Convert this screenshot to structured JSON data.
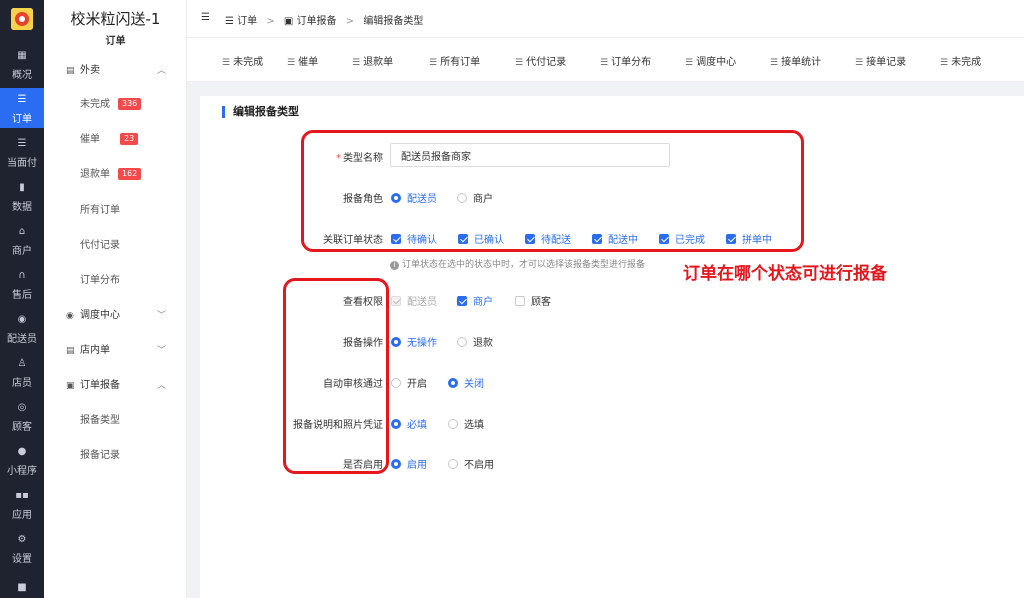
{
  "rail": {
    "items": [
      {
        "label": "概况",
        "icon": "grid-icon"
      },
      {
        "label": "订单",
        "icon": "list-icon"
      },
      {
        "label": "当面付",
        "icon": "list-icon"
      },
      {
        "label": "数据",
        "icon": "bar-chart-icon"
      },
      {
        "label": "商户",
        "icon": "store-icon"
      },
      {
        "label": "售后",
        "icon": "headset-icon"
      },
      {
        "label": "配送员",
        "icon": "scooter-icon"
      },
      {
        "label": "店员",
        "icon": "users-icon"
      },
      {
        "label": "顾客",
        "icon": "user-circle-icon"
      },
      {
        "label": "小程序",
        "icon": "wechat-icon"
      },
      {
        "label": "应用",
        "icon": "apps-icon"
      },
      {
        "label": "设置",
        "icon": "settings-icon"
      }
    ]
  },
  "sidebar": {
    "title": "校米粒闪送-1",
    "subtitle": "订单",
    "groups": {
      "takeout": "外卖",
      "dispatch": "调度中心",
      "instore": "店内单",
      "report": "订单报备"
    },
    "items": {
      "unfinished": "未完成",
      "unfinished_badge": "336",
      "urge": "催单",
      "urge_badge": "23",
      "refund": "退款单",
      "refund_badge": "162",
      "all": "所有订单",
      "paid": "代付记录",
      "distribution": "订单分布",
      "report_type": "报备类型",
      "report_record": "报备记录"
    }
  },
  "breadcrumb": {
    "orders": "订单",
    "report": "订单报备",
    "current": "编辑报备类型",
    "sep": ">"
  },
  "tabs": [
    "未完成",
    "催单",
    "退款单",
    "所有订单",
    "代付记录",
    "订单分布",
    "调度中心",
    "接单统计",
    "接单记录",
    "未完成"
  ],
  "form": {
    "card_title": "编辑报备类型",
    "type_name_label": "类型名称",
    "type_name_value": "配送员报备商家",
    "role_label": "报备角色",
    "role_options": {
      "courier": "配送员",
      "merchant": "商户"
    },
    "status_label": "关联订单状态",
    "status_options": [
      "待确认",
      "已确认",
      "待配送",
      "配送中",
      "已完成",
      "拼单中"
    ],
    "status_hint": "订单状态在选中的状态中时，才可以选择该报备类型进行报备",
    "view_label": "查看权限",
    "view_options": {
      "courier": "配送员",
      "merchant": "商户",
      "customer": "顾客"
    },
    "op_label": "报备操作",
    "op_options": {
      "none": "无操作",
      "refund": "退款"
    },
    "audit_label": "自动审核通过",
    "audit_options": {
      "on": "开启",
      "off": "关闭"
    },
    "desc_label": "报备说明和照片凭证",
    "desc_options": {
      "required": "必填",
      "optional": "选填"
    },
    "enable_label": "是否启用",
    "enable_options": {
      "on": "启用",
      "off": "不启用"
    }
  },
  "annotation": "订单在哪个状态可进行报备",
  "colors": {
    "accent": "#2b6df2",
    "rail_bg": "#1f2330",
    "badge": "#f44a4a",
    "annotation": "#e5171c"
  }
}
